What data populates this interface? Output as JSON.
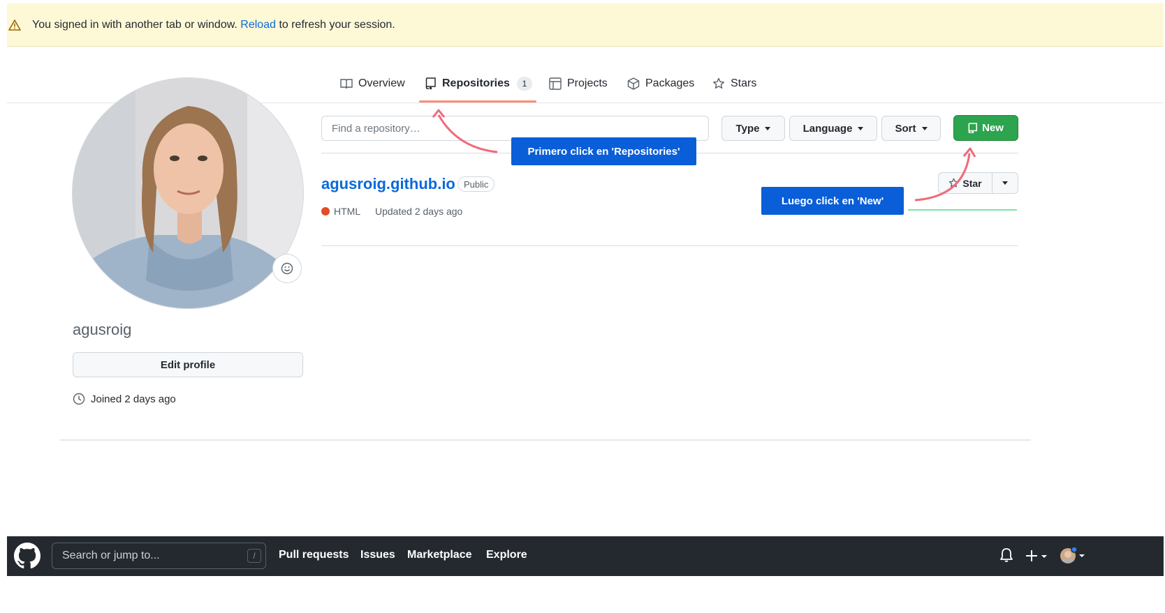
{
  "flash": {
    "icon": "alert-icon",
    "text_before": "You signed in with another tab or window.",
    "link": "Reload",
    "text_after": "to refresh your session."
  },
  "tabs": [
    {
      "label": "Overview",
      "icon": "book-icon"
    },
    {
      "label": "Repositories",
      "icon": "repo-icon",
      "counter": "1",
      "selected": true
    },
    {
      "label": "Projects",
      "icon": "table-icon"
    },
    {
      "label": "Packages",
      "icon": "package-icon"
    },
    {
      "label": "Stars",
      "icon": "star-icon"
    }
  ],
  "profile": {
    "username": "agusroig",
    "edit_label": "Edit profile",
    "joined": "Joined 2 days ago"
  },
  "filters": {
    "search_placeholder": "Find a repository…",
    "type_label": "Type",
    "language_label": "Language",
    "sort_label": "Sort",
    "new_label": "New"
  },
  "repo": {
    "name": "agusroig.github.io",
    "visibility": "Public",
    "language": "HTML",
    "language_color": "#e34c26",
    "updated": "Updated 2 days ago",
    "star_label": "Star"
  },
  "annotations": {
    "first": "Primero click en 'Repositories'",
    "second": "Luego click en 'New'",
    "color": "#0a5ed7",
    "arrow_color": "#f06a7a"
  },
  "nav": {
    "search_placeholder": "Search or jump to...",
    "slash": "/",
    "links": [
      "Pull requests",
      "Issues",
      "Marketplace",
      "Explore"
    ]
  }
}
